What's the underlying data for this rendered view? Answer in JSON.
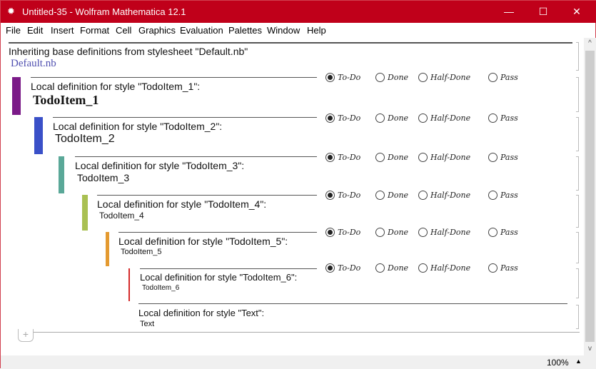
{
  "window": {
    "title": "Untitled-35 - Wolfram Mathematica 12.1",
    "controls": {
      "minimize": "—",
      "maximize": "☐",
      "close": "✕"
    }
  },
  "menu": [
    "File",
    "Edit",
    "Insert",
    "Format",
    "Cell",
    "Graphics",
    "Evaluation",
    "Palettes",
    "Window",
    "Help"
  ],
  "header": {
    "inherit_text": "Inheriting base definitions from stylesheet \"Default.nb\"",
    "link": "Default.nb"
  },
  "rows": [
    {
      "label": "Local definition for style \"TodoItem_1\":",
      "style_name": "TodoItem_1",
      "color": "#7b1a88"
    },
    {
      "label": "Local definition for style \"TodoItem_2\":",
      "style_name": "TodoItem_2",
      "color": "#3a50c8"
    },
    {
      "label": "Local definition for style \"TodoItem_3\":",
      "style_name": "TodoItem_3",
      "color": "#5aa898"
    },
    {
      "label": "Local definition for style \"TodoItem_4\":",
      "style_name": "TodoItem_4",
      "color": "#a9c052"
    },
    {
      "label": "Local definition for style \"TodoItem_5\":",
      "style_name": "TodoItem_5",
      "color": "#e49a30"
    },
    {
      "label": "Local definition for style \"TodoItem_6\":",
      "style_name": "TodoItem_6",
      "color": "#d42a2a"
    }
  ],
  "radio_options": [
    "To-Do",
    "Done",
    "Half-Done",
    "Pass"
  ],
  "selected_option": "To-Do",
  "text_row": {
    "label": "Local definition for style \"Text\":",
    "style_name": "Text"
  },
  "add_cell": "+",
  "status": {
    "zoom": "100%",
    "zoom_arrow": "▲"
  },
  "scroll": {
    "up": "^",
    "down": "v"
  }
}
